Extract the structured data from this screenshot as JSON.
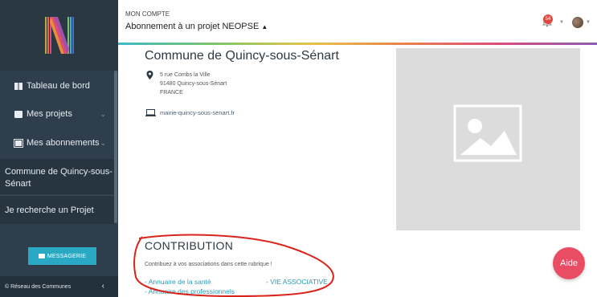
{
  "header": {
    "account_label": "MON COMPTE",
    "project_title": "Abonnement à un projet NEOPSE",
    "notification_count": "54"
  },
  "sidebar": {
    "items": [
      {
        "label": "Tableau de bord",
        "icon": "dashboard-icon"
      },
      {
        "label": "Mes projets",
        "icon": "folder-icon"
      },
      {
        "label": "Mes abonnements",
        "icon": "subscriptions-icon"
      }
    ],
    "active_sub": "Commune de Quincy-sous-Sénart",
    "search_label": "Je recherche un Projet",
    "message_button": "MESSAGERIE",
    "footer": "© Réseau des Communes"
  },
  "main": {
    "title": "Commune de Quincy-sous-Sénart",
    "address": {
      "line1": "5 rue Combs la Ville",
      "line2": "91480 Quincy-sous-Sénart",
      "line3": "FRANCE"
    },
    "website": "mairie-quincy-sous-senart.fr"
  },
  "contribution": {
    "title": "CONTRIBUTION",
    "description": "Contribuez à vos associations dans cette rubrique !",
    "links": [
      "- Annuaire de la santé",
      "- VIE ASSOCIATIVE",
      "- Annuaire des professionnels"
    ]
  },
  "help_button": "Aide",
  "colors": {
    "sidebar": "#2f3e4c",
    "accent": "#2aa9c4",
    "help": "#ea4c64",
    "annotation": "#d9241c"
  }
}
